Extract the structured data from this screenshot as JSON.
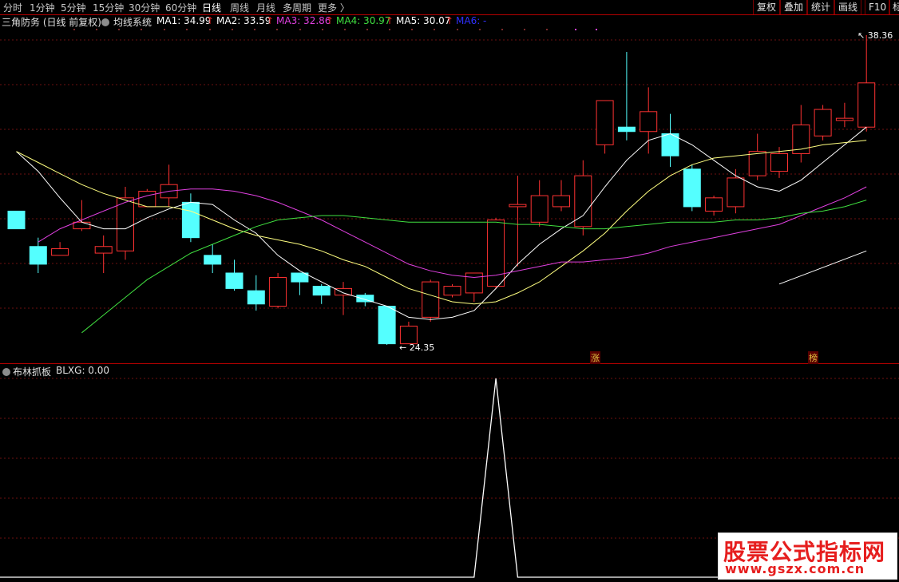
{
  "toolbar": {
    "periods": [
      "分时",
      "1分钟",
      "5分钟",
      "15分钟",
      "30分钟",
      "60分钟",
      "日线",
      "周线",
      "月线",
      "多周期",
      "更多 〉"
    ],
    "active_period": "日线",
    "right_buttons": [
      "复权",
      "叠加",
      "统计",
      "画线",
      "F10",
      "标"
    ]
  },
  "main_panel": {
    "title": "三角防务 (日线 前复权)",
    "indicator": "均线系统",
    "ma_values": [
      {
        "label": "MA1: 34.99",
        "color": "#ffffff"
      },
      {
        "label": "MA2: 33.59",
        "color": "#ffffff"
      },
      {
        "label": "MA3: 32.86",
        "color": "#e040e0"
      },
      {
        "label": "MA4: 30.97",
        "color": "#40e040"
      },
      {
        "label": "MA5: 30.07",
        "color": "#ffffff"
      },
      {
        "label": "MA6: -",
        "color": "#3030ff"
      }
    ],
    "high_label": "38.36",
    "low_label": "24.35",
    "marker_zhang": "涨",
    "marker_bang": "榜"
  },
  "sub_panel": {
    "indicator": "布林抓板",
    "value_label": "BLXG: 0.00"
  },
  "watermark": {
    "title": "股票公式指标网",
    "url": "www.gszx.com.cn"
  },
  "chart_data": {
    "type": "candlestick",
    "price_range": [
      24.35,
      38.36
    ],
    "candles": [
      {
        "o": 30.4,
        "c": 29.6,
        "h": 30.4,
        "l": 29.6
      },
      {
        "o": 28.8,
        "c": 28.0,
        "h": 29.2,
        "l": 27.6
      },
      {
        "o": 28.4,
        "c": 28.7,
        "h": 29.0,
        "l": 28.4
      },
      {
        "o": 29.6,
        "c": 29.9,
        "h": 30.9,
        "l": 29.5
      },
      {
        "o": 28.5,
        "c": 28.8,
        "h": 29.3,
        "l": 27.6
      },
      {
        "o": 28.6,
        "c": 31.0,
        "h": 31.5,
        "l": 28.2
      },
      {
        "o": 30.6,
        "c": 31.3,
        "h": 31.4,
        "l": 30.6
      },
      {
        "o": 31.0,
        "c": 31.6,
        "h": 32.5,
        "l": 30.6
      },
      {
        "o": 30.8,
        "c": 29.2,
        "h": 31.2,
        "l": 29.0
      },
      {
        "o": 28.4,
        "c": 28.0,
        "h": 28.9,
        "l": 27.6
      },
      {
        "o": 27.6,
        "c": 26.9,
        "h": 28.2,
        "l": 26.8
      },
      {
        "o": 26.8,
        "c": 26.2,
        "h": 27.5,
        "l": 25.9
      },
      {
        "o": 26.1,
        "c": 27.4,
        "h": 27.6,
        "l": 26.0
      },
      {
        "o": 27.6,
        "c": 27.2,
        "h": 27.6,
        "l": 26.6
      },
      {
        "o": 27.0,
        "c": 26.6,
        "h": 27.1,
        "l": 26.2
      },
      {
        "o": 26.6,
        "c": 26.9,
        "h": 27.2,
        "l": 25.7
      },
      {
        "o": 26.6,
        "c": 26.3,
        "h": 26.7,
        "l": 26.1
      },
      {
        "o": 26.1,
        "c": 24.4,
        "h": 26.1,
        "l": 24.35
      },
      {
        "o": 24.4,
        "c": 25.2,
        "h": 25.4,
        "l": 24.4
      },
      {
        "o": 25.6,
        "c": 27.2,
        "h": 27.3,
        "l": 25.4
      },
      {
        "o": 26.6,
        "c": 27.0,
        "h": 27.1,
        "l": 26.5
      },
      {
        "o": 26.7,
        "c": 27.6,
        "h": 27.6,
        "l": 26.3
      },
      {
        "o": 27.0,
        "c": 30.0,
        "h": 30.1,
        "l": 26.9
      },
      {
        "o": 30.6,
        "c": 30.7,
        "h": 32.0,
        "l": 27.9
      },
      {
        "o": 29.9,
        "c": 31.1,
        "h": 31.8,
        "l": 29.7
      },
      {
        "o": 30.6,
        "c": 31.1,
        "h": 31.8,
        "l": 30.4
      },
      {
        "o": 29.7,
        "c": 32.0,
        "h": 32.7,
        "l": 29.3
      },
      {
        "o": 33.4,
        "c": 35.4,
        "h": 35.4,
        "l": 33.0
      },
      {
        "o": 34.2,
        "c": 34.0,
        "h": 37.6,
        "l": 33.6
      },
      {
        "o": 34.0,
        "c": 34.9,
        "h": 36.0,
        "l": 33.0
      },
      {
        "o": 33.9,
        "c": 32.9,
        "h": 34.8,
        "l": 32.4
      },
      {
        "o": 32.3,
        "c": 30.6,
        "h": 32.5,
        "l": 30.4
      },
      {
        "o": 30.4,
        "c": 31.0,
        "h": 31.1,
        "l": 30.2
      },
      {
        "o": 30.6,
        "c": 31.9,
        "h": 32.3,
        "l": 30.3
      },
      {
        "o": 32.0,
        "c": 33.1,
        "h": 33.9,
        "l": 31.8
      },
      {
        "o": 32.2,
        "c": 33.0,
        "h": 33.3,
        "l": 31.9
      },
      {
        "o": 33.0,
        "c": 34.3,
        "h": 35.2,
        "l": 32.6
      },
      {
        "o": 33.8,
        "c": 35.0,
        "h": 35.2,
        "l": 33.6
      },
      {
        "o": 34.5,
        "c": 34.6,
        "h": 35.3,
        "l": 34.2
      },
      {
        "o": 34.2,
        "c": 36.2,
        "h": 38.36,
        "l": 34.0
      }
    ],
    "ma1": [
      33.1,
      32.2,
      31.0,
      29.9,
      29.6,
      29.6,
      30.1,
      30.5,
      30.8,
      30.7,
      30.0,
      29.4,
      28.4,
      27.7,
      27.2,
      26.7,
      26.4,
      26.1,
      25.6,
      25.5,
      25.6,
      25.9,
      26.9,
      28.0,
      28.9,
      29.6,
      30.2,
      31.5,
      32.7,
      33.6,
      33.9,
      33.4,
      32.7,
      32.0,
      31.5,
      31.3,
      31.8,
      32.6,
      33.4,
      34.2
    ],
    "ma2": [
      33.1,
      32.6,
      32.1,
      31.6,
      31.2,
      30.9,
      30.6,
      30.6,
      30.4,
      30.0,
      29.6,
      29.3,
      29.1,
      28.9,
      28.6,
      28.2,
      27.9,
      27.4,
      26.9,
      26.6,
      26.3,
      26.2,
      26.3,
      26.7,
      27.2,
      27.9,
      28.6,
      29.4,
      30.4,
      31.3,
      32.0,
      32.5,
      32.8,
      32.9,
      33.0,
      33.1,
      33.2,
      33.4,
      33.5,
      33.6
    ],
    "ma3": [
      null,
      29.0,
      29.6,
      30.0,
      30.4,
      30.8,
      31.1,
      31.3,
      31.4,
      31.4,
      31.3,
      31.1,
      30.8,
      30.4,
      30.0,
      29.5,
      29.0,
      28.5,
      28.0,
      27.7,
      27.5,
      27.4,
      27.5,
      27.7,
      27.9,
      28.1,
      28.1,
      28.2,
      28.3,
      28.5,
      28.8,
      29.0,
      29.2,
      29.4,
      29.6,
      29.8,
      30.2,
      30.6,
      31.0,
      31.5
    ],
    "ma4": [
      null,
      null,
      null,
      24.9,
      25.7,
      26.5,
      27.3,
      27.9,
      28.5,
      28.9,
      29.3,
      29.7,
      30.0,
      30.1,
      30.2,
      30.2,
      30.1,
      30.0,
      29.9,
      29.9,
      29.9,
      29.9,
      29.9,
      29.8,
      29.8,
      29.7,
      29.6,
      29.6,
      29.7,
      29.8,
      29.9,
      29.9,
      29.9,
      30.0,
      30.0,
      30.1,
      30.3,
      30.4,
      30.6,
      30.9
    ],
    "ma5_segment": {
      "from": [
        35,
        27.1
      ],
      "to": [
        39,
        28.6
      ]
    },
    "blxg": [
      0,
      0,
      0,
      0,
      0,
      0,
      0,
      0,
      0,
      0,
      0,
      0,
      0,
      0,
      0,
      0,
      0,
      0,
      0,
      0,
      0,
      0,
      1,
      0,
      0,
      0,
      0,
      0,
      0,
      0,
      0,
      0,
      0,
      0,
      0,
      0,
      0,
      0,
      0,
      0
    ]
  }
}
